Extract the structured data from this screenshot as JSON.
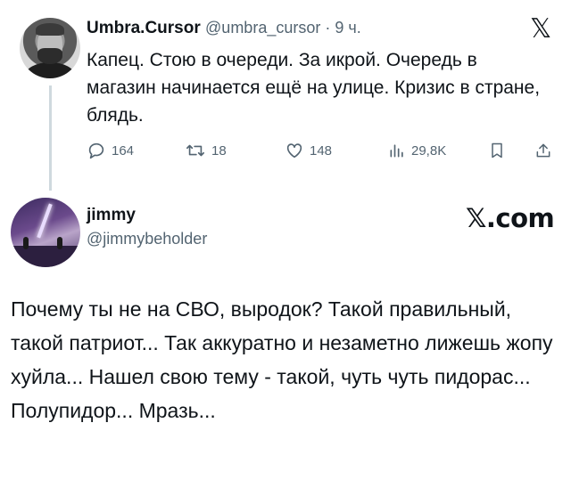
{
  "tweet1": {
    "author_name": "Umbra.Cursor",
    "author_handle": "@umbra_cursor",
    "separator": " · ",
    "time": "9 ч.",
    "x_logo": "𝕏",
    "text": "Капец. Стою в очереди. За икрой. Очередь в магазин начинается ещё на улице. Кризис в стране, блядь.",
    "stats": {
      "replies": "164",
      "retweets": "18",
      "likes": "148",
      "views": "29,8K"
    }
  },
  "tweet2": {
    "author_name": "jimmy",
    "author_handle": "@jimmybeholder",
    "x_brand": "𝕏.com",
    "text": "Почему ты не на СВО, выродок? Такой правильный, такой патриот... Так аккуратно и незаметно лижешь жопу хуйла... Нашел свою тему - такой, чуть чуть пидорас... Полупидор... Мразь..."
  },
  "icons": [
    "reply-icon",
    "retweet-icon",
    "like-icon",
    "views-icon",
    "bookmark-icon",
    "share-icon"
  ],
  "colors": {
    "text": "#0f1419",
    "secondary": "#536471",
    "thread_line": "#cfd9de"
  }
}
